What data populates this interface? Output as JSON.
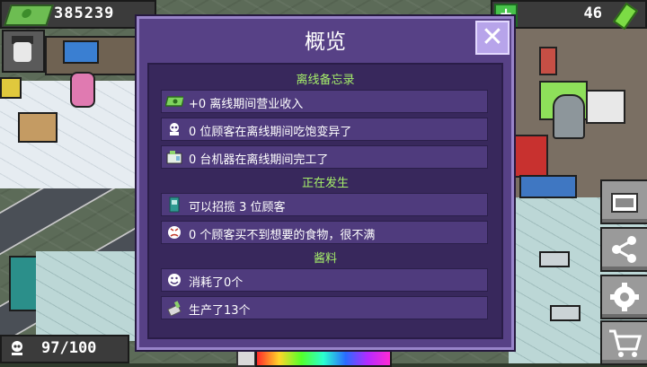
{
  "hud": {
    "money": "385239",
    "gems": "46",
    "capacity": "97/100"
  },
  "dialog": {
    "title": "概览",
    "close_glyph": "✕",
    "sections": {
      "offline": "离线备忘录",
      "happening": "正在发生",
      "sauce": "酱料"
    },
    "rows": [
      {
        "icon": "cash-icon",
        "text": "+0 离线期间营业收入"
      },
      {
        "icon": "customer-skull-icon",
        "text": "0 位顾客在离线期间吃饱变异了"
      },
      {
        "icon": "machine-icon",
        "text": "0 台机器在离线期间完工了"
      },
      {
        "icon": "booth-icon",
        "text": "可以招揽 3 位顾客"
      },
      {
        "icon": "angry-face-icon",
        "text": "0 个顾客买不到想要的食物，很不满"
      },
      {
        "icon": "smiley-icon",
        "text": "消耗了0个"
      },
      {
        "icon": "sauce-bottle-icon",
        "text": "生产了13个"
      }
    ]
  },
  "side_buttons": [
    "photo-button",
    "share-button",
    "settings-button",
    "shop-button"
  ],
  "colors": {
    "dialog_bg": "#574186",
    "panel_bg": "#38285c",
    "row_bg": "#4f3b7d",
    "section_green": "#a6ef6a",
    "close_bg": "#b7a4ea"
  }
}
